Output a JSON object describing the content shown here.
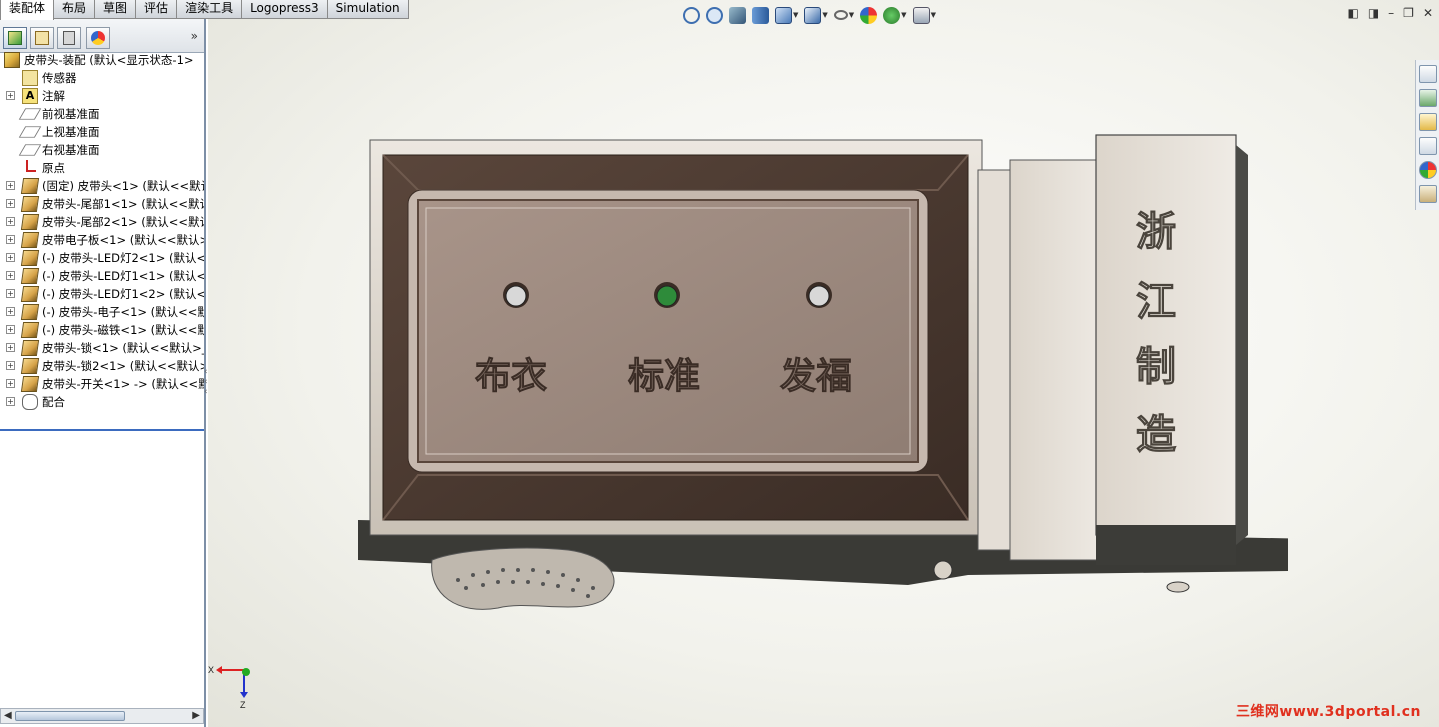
{
  "tabs": [
    {
      "label": "装配体",
      "active": true
    },
    {
      "label": "布局",
      "active": false
    },
    {
      "label": "草图",
      "active": false
    },
    {
      "label": "评估",
      "active": false
    },
    {
      "label": "渲染工具",
      "active": false
    },
    {
      "label": "Logopress3",
      "active": false
    },
    {
      "label": "Simulation",
      "active": false
    }
  ],
  "feature_tree": {
    "root": "皮带头-装配  (默认<显示状态-1>",
    "items": [
      {
        "label": "传感器",
        "icon": "sensor-icon",
        "expandable": false
      },
      {
        "label": "注解",
        "icon": "annotation-icon",
        "expandable": true
      },
      {
        "label": "前视基准面",
        "icon": "plane-icon",
        "expandable": false
      },
      {
        "label": "上视基准面",
        "icon": "plane-icon",
        "expandable": false
      },
      {
        "label": "右视基准面",
        "icon": "plane-icon",
        "expandable": false
      },
      {
        "label": "原点",
        "icon": "origin-icon",
        "expandable": false
      },
      {
        "label": "(固定) 皮带头<1> (默认<<默认",
        "icon": "part-icon",
        "expandable": true
      },
      {
        "label": "皮带头-尾部1<1> (默认<<默认",
        "icon": "part-icon",
        "expandable": true
      },
      {
        "label": "皮带头-尾部2<1> (默认<<默认",
        "icon": "part-icon",
        "expandable": true
      },
      {
        "label": "皮带电子板<1> (默认<<默认>_",
        "icon": "part-icon",
        "expandable": true
      },
      {
        "label": "(-) 皮带头-LED灯2<1> (默认<",
        "icon": "part-icon",
        "expandable": true
      },
      {
        "label": "(-) 皮带头-LED灯1<1> (默认<",
        "icon": "part-icon",
        "expandable": true
      },
      {
        "label": "(-) 皮带头-LED灯1<2> (默认<",
        "icon": "part-icon",
        "expandable": true
      },
      {
        "label": "(-) 皮带头-电子<1> (默认<<默",
        "icon": "part-icon",
        "expandable": true
      },
      {
        "label": "(-) 皮带头-磁铁<1> (默认<<默",
        "icon": "part-icon",
        "expandable": true
      },
      {
        "label": "皮带头-锁<1> (默认<<默认>_显",
        "icon": "part-icon",
        "expandable": true
      },
      {
        "label": "皮带头-锁2<1> (默认<<默认>_",
        "icon": "part-icon",
        "expandable": true
      },
      {
        "label": "皮带头-开关<1> -> (默认<<默",
        "icon": "part-icon",
        "expandable": true
      },
      {
        "label": "配合",
        "icon": "mate-icon",
        "expandable": true
      }
    ]
  },
  "model": {
    "plate_labels": [
      "布衣",
      "标准",
      "发福"
    ],
    "side_labels": [
      "浙",
      "江",
      "制",
      "造"
    ],
    "led_colors": [
      "#d8d8d8",
      "#2e8b3a",
      "#d8d8d8"
    ]
  },
  "triad": {
    "x_label": "X",
    "z_label": "Z"
  },
  "watermark": "三维网www.3dportal.cn",
  "colors": {
    "accent": "#3b6bbf",
    "body_metal": "#d9d2c8",
    "recess": "#4a3a32",
    "plate": "#9b8a80"
  }
}
